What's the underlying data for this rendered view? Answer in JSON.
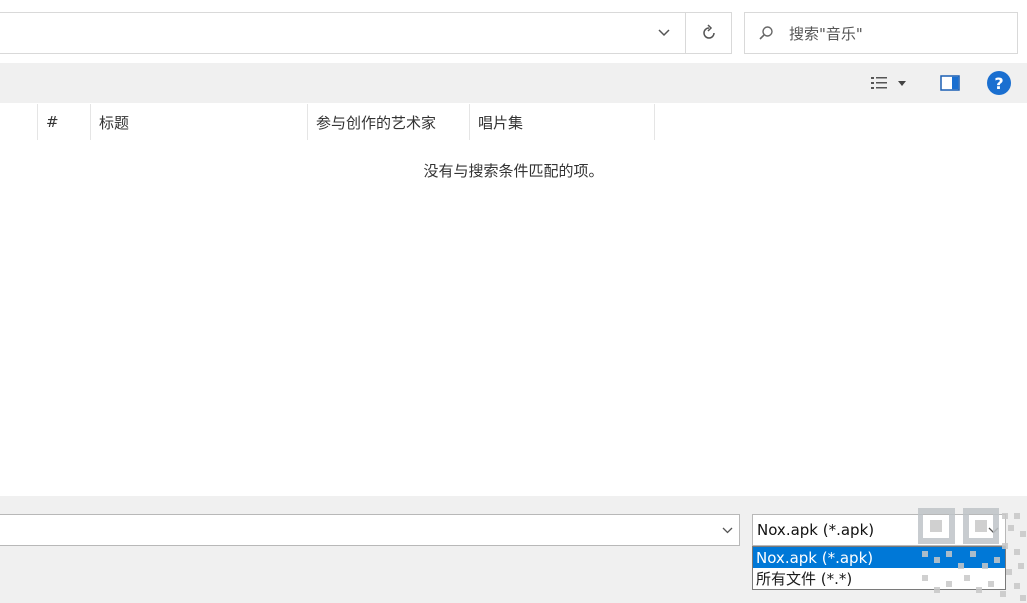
{
  "addressbar": {
    "value": "",
    "dropdown_icon": "chevron-down-icon",
    "refresh_icon": "refresh-icon"
  },
  "search": {
    "placeholder": "搜索\"音乐\"",
    "icon": "search-icon"
  },
  "toolbar": {
    "view_icon": "view-list-icon",
    "view_dropdown_icon": "caret-down-icon",
    "pane_icon": "preview-pane-icon",
    "help_label": "?"
  },
  "columns": [
    "#",
    "标题",
    "参与创作的艺术家",
    "唱片集"
  ],
  "empty_message": "没有与搜索条件匹配的项。",
  "filename": {
    "value": ""
  },
  "filetype": {
    "selected": "Nox.apk (*.apk)",
    "options": [
      "Nox.apk (*.apk)",
      "所有文件 (*.*)"
    ],
    "highlighted_index": 0
  },
  "colors": {
    "accent": "#0078d7",
    "help": "#1a6fd0",
    "toolbar_bg": "#f0f0f0"
  }
}
